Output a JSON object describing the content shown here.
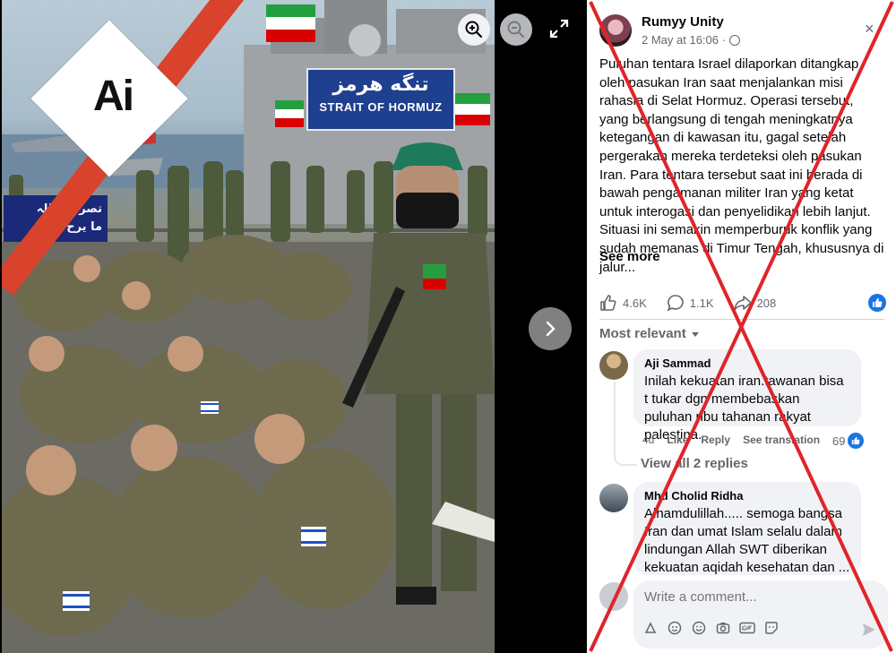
{
  "photo": {
    "ship_sign_fa": "تنگه هرمز",
    "ship_sign_en": "STRAIT OF HORMUZ",
    "banner_line1": "تصرعن اللہ",
    "banner_line2": "ما یرح",
    "ai_badge": "Ai"
  },
  "viewer": {
    "zoom_in_icon": "zoom-in-icon",
    "zoom_out_icon": "zoom-out-icon",
    "expand_icon": "expand-icon",
    "next_icon": "chevron-right-icon"
  },
  "post": {
    "author": "Rumyy Unity",
    "date": "2 May at 16:06 ·",
    "privacy_icon": "globe-icon",
    "close": "×",
    "text": "Puluhan tentara Israel dilaporkan ditangkap oleh pasukan Iran saat menjalankan misi rahasia di Selat Hormuz. Operasi tersebut, yang berlangsung di tengah meningkatnya ketegangan di kawasan itu, gagal setelah pergerakan mereka terdeteksi oleh pasukan Iran. Para tentara tersebut saat ini berada di bawah pengamanan militer Iran yang ketat untuk interogasi dan penyelidikan lebih lanjut. Situasi ini semakin memperburuk konflik yang sudah memanas di Timur Tengah, khususnya di jalur...",
    "see_more": "See more",
    "likes": "4.6K",
    "comments": "1.1K",
    "shares": "208"
  },
  "comments_section": {
    "sort_label": "Most relevant",
    "items": [
      {
        "name": "Aji Sammad",
        "text": "Inilah kekuatan iran.tawanan bisa t tukar dgn membebaskan puluhan ribu tahanan rakyat palestina.",
        "age": "4d",
        "like": "Like",
        "reply": "Reply",
        "translate": "See translation",
        "reactions": "69"
      },
      {
        "name": "Mhd Cholid Ridha",
        "text": "Alhamdulillah..... semoga bangsa Iran dan umat Islam selalu dalam lindungan Allah SWT diberikan kekuatan aqidah kesehatan dan ..."
      }
    ],
    "view_replies": "View all 2 replies"
  },
  "composer": {
    "placeholder": "Write a comment..."
  },
  "colors": {
    "fb_blue": "#1b74e4",
    "overlay_red": "#e0242a",
    "ship_sign": "#1f3f8f"
  }
}
